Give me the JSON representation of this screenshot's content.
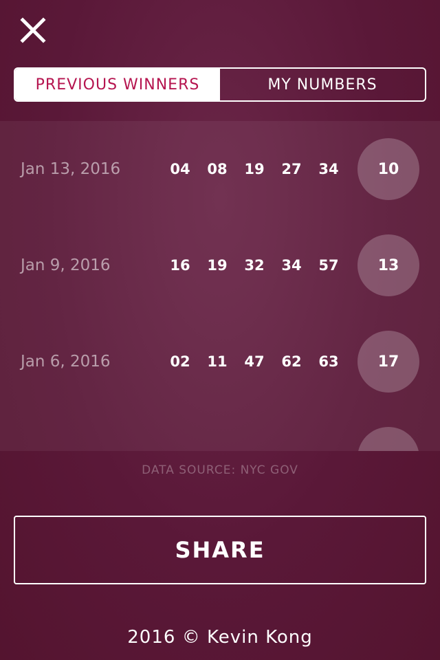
{
  "header": {
    "close_icon": "close-icon"
  },
  "tabs": [
    {
      "label": "PREVIOUS WINNERS",
      "active": true
    },
    {
      "label": "MY NUMBERS",
      "active": false
    }
  ],
  "winners": [
    {
      "date": "Jan 13, 2016",
      "numbers": [
        "04",
        "08",
        "19",
        "27",
        "34"
      ],
      "bonus": "10"
    },
    {
      "date": "Jan 9, 2016",
      "numbers": [
        "16",
        "19",
        "32",
        "34",
        "57"
      ],
      "bonus": "13"
    },
    {
      "date": "Jan 6, 2016",
      "numbers": [
        "02",
        "11",
        "47",
        "62",
        "63"
      ],
      "bonus": "17"
    }
  ],
  "data_source": "DATA SOURCE: NYC GOV",
  "share_label": "SHARE",
  "footer": "2016 © Kevin Kong",
  "colors": {
    "background": "#5a1838",
    "accent": "#b5144f"
  }
}
